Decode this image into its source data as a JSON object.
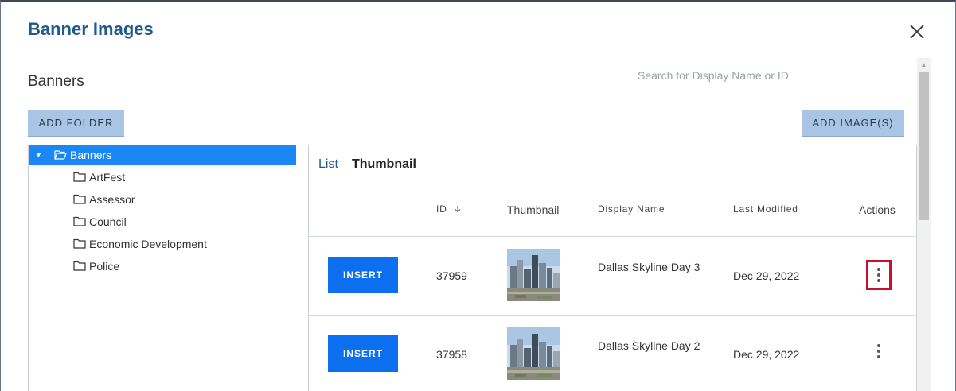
{
  "modal": {
    "title": "Banner Images",
    "close_icon": "close-icon"
  },
  "section": {
    "title": "Banners"
  },
  "search": {
    "placeholder": "Search for Display Name or ID",
    "value": ""
  },
  "buttons": {
    "add_folder": "ADD FOLDER",
    "add_images": "ADD IMAGE(S)"
  },
  "tree": {
    "root": {
      "label": "Banners",
      "expanded": true,
      "selected": true
    },
    "items": [
      {
        "label": "ArtFest"
      },
      {
        "label": "Assessor"
      },
      {
        "label": "Council"
      },
      {
        "label": "Economic Development"
      },
      {
        "label": "Police"
      }
    ]
  },
  "views": {
    "list": "List",
    "thumbnail": "Thumbnail",
    "active": "thumbnail"
  },
  "table": {
    "headers": {
      "id": "ID",
      "thumbnail": "Thumbnail",
      "display_name": "Display Name",
      "last_modified": "Last Modified",
      "actions": "Actions"
    },
    "sort_icon": "arrow-down-icon",
    "rows": [
      {
        "insert_label": "INSERT",
        "id": "37959",
        "display_name": "Dallas Skyline Day 3",
        "last_modified": "Dec 29, 2022",
        "actions_highlighted": true
      },
      {
        "insert_label": "INSERT",
        "id": "37958",
        "display_name": "Dallas Skyline Day 2",
        "last_modified": "Dec 29, 2022",
        "actions_highlighted": false
      }
    ]
  },
  "colors": {
    "title": "#1f5a8c",
    "selected": "#1b87f5",
    "primary_button": "#0b6ff0",
    "secondary_button": "#a9c4e4",
    "highlight": "#c8102e"
  }
}
